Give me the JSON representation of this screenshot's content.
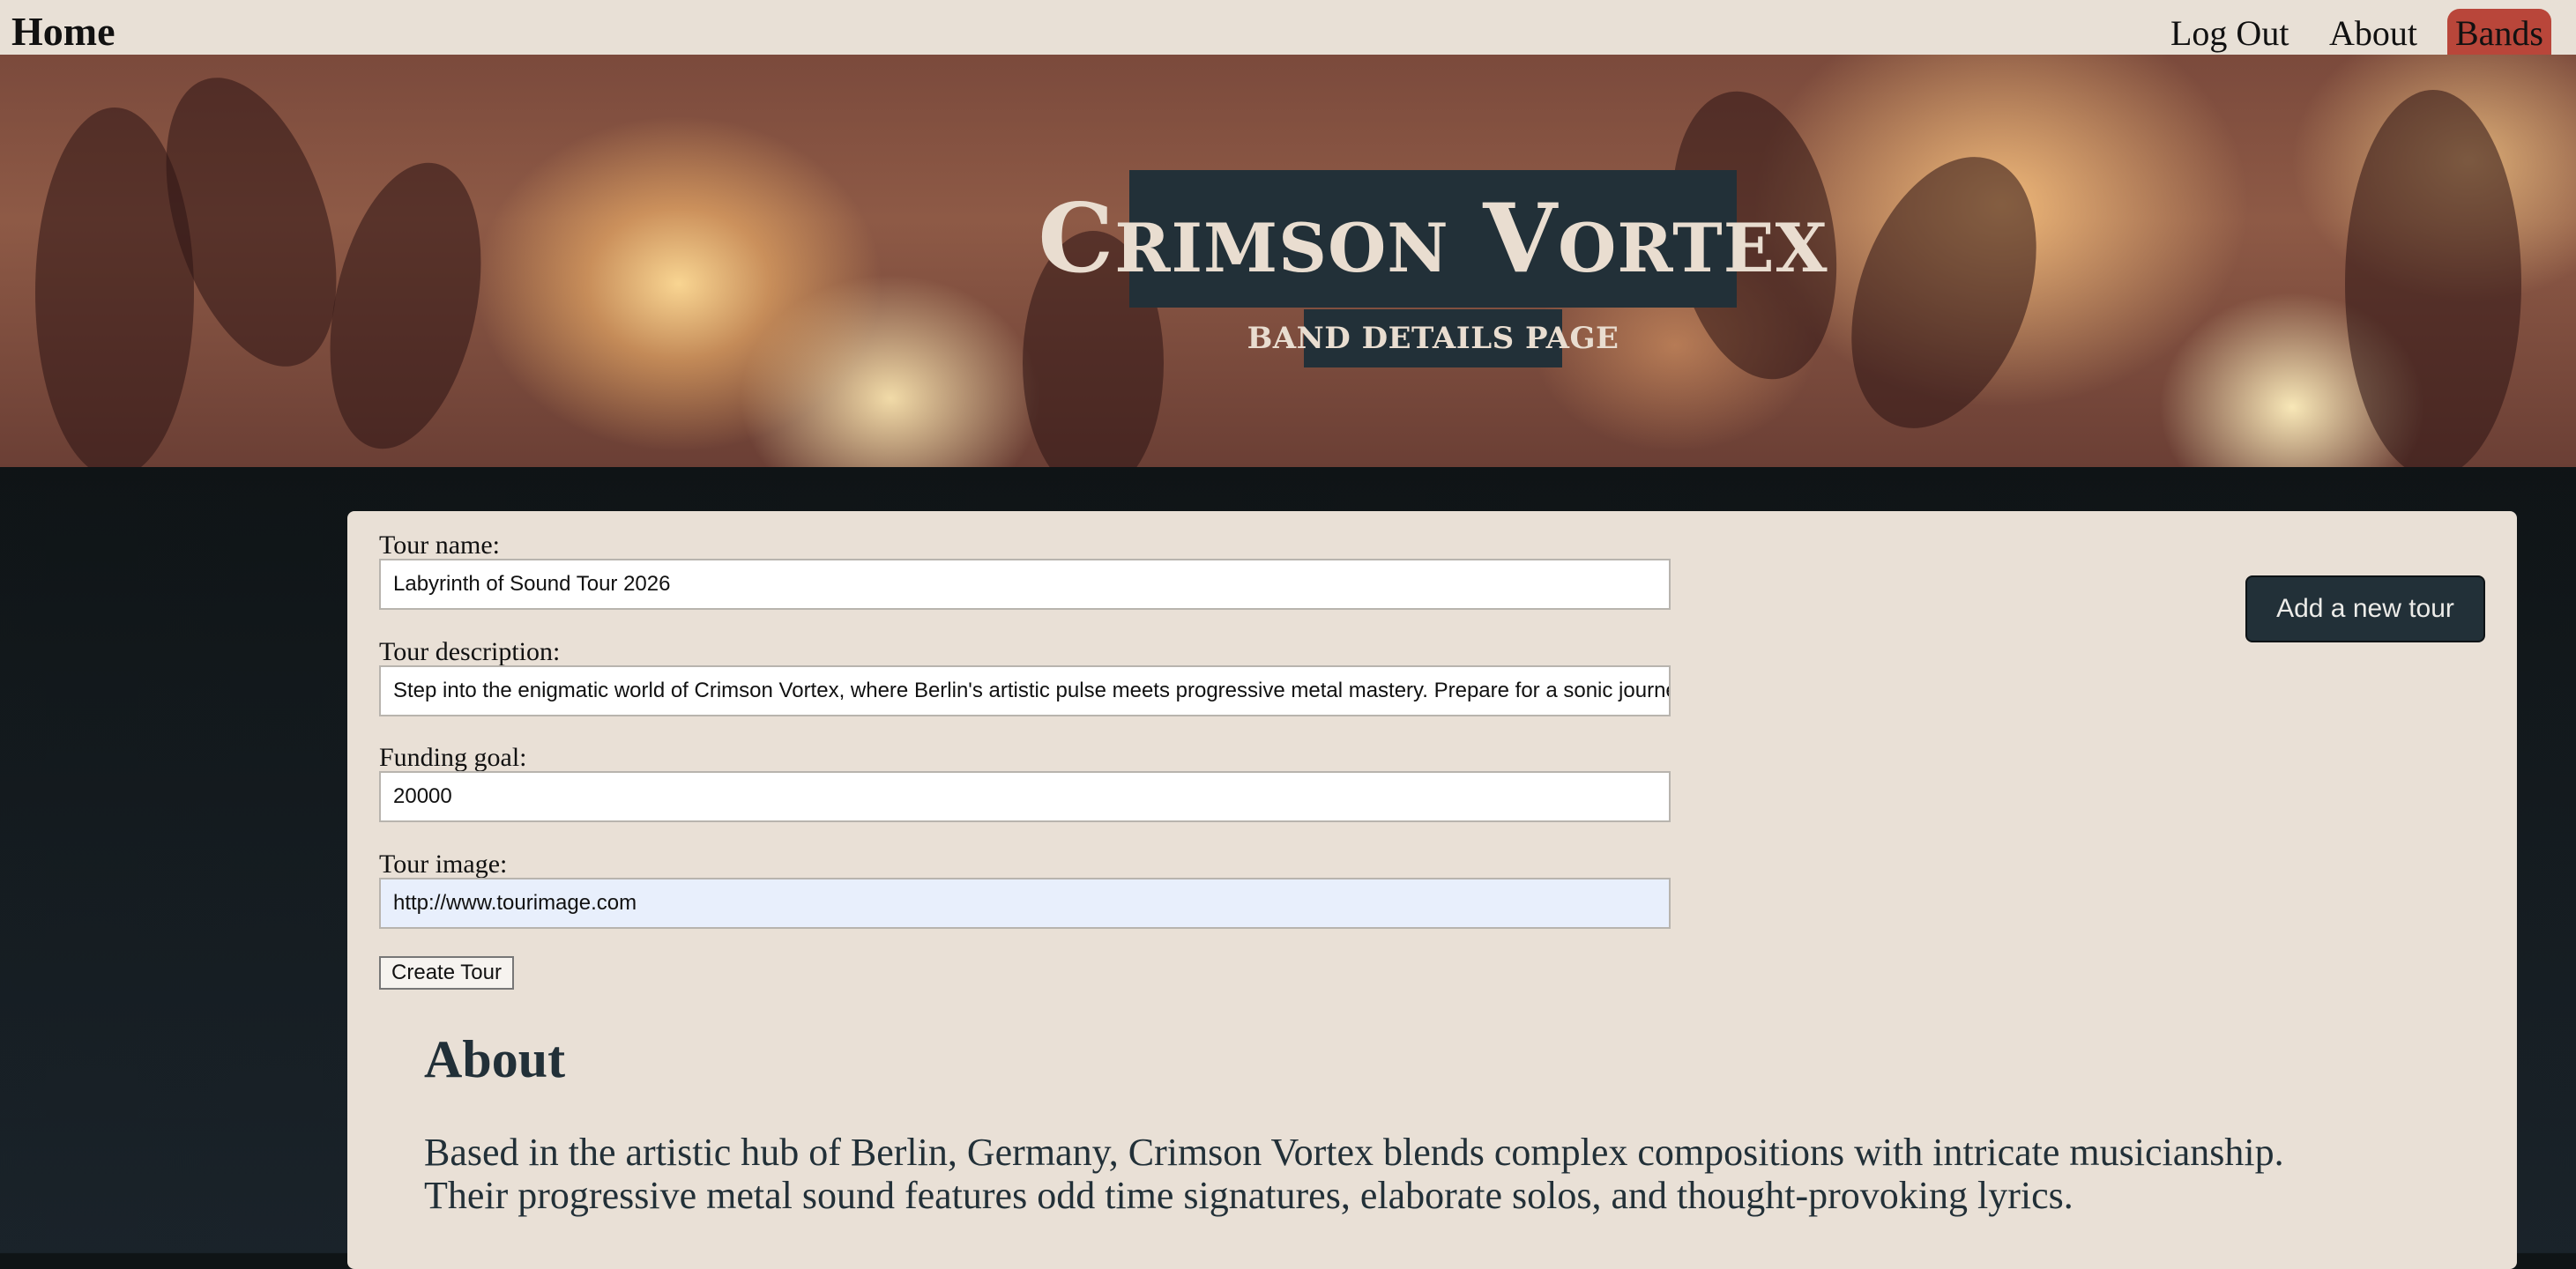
{
  "nav": {
    "home_label": "Home",
    "logout_label": "Log Out",
    "about_label": "About",
    "bands_label": "Bands"
  },
  "hero": {
    "band_name": "Crimson Vortex",
    "subtitle": "Band Details Page"
  },
  "tour_form": {
    "name_label": "Tour name:",
    "name_value": "Labyrinth of Sound Tour 2026",
    "description_label": "Tour description:",
    "description_value": "Step into the enigmatic world of Crimson Vortex, where Berlin's artistic pulse meets progressive metal mastery. Prepare for a sonic journey",
    "funding_label": "Funding goal:",
    "funding_value": "20000",
    "image_label": "Tour image:",
    "image_value": "http://www.tourimage.com",
    "submit_label": "Create Tour"
  },
  "actions": {
    "add_tour_label": "Add a new tour"
  },
  "about": {
    "heading": "About",
    "text": "Based in the artistic hub of Berlin, Germany, Crimson Vortex blends complex compositions with intricate musicianship. Their progressive metal sound features odd time signatures, elaborate solos, and thought-provoking lyrics."
  },
  "colors": {
    "nav_bg": "#e8e0d6",
    "active_tab": "#b9463a",
    "dark_accent": "#223038",
    "panel_bg": "#e9e0d6",
    "page_bg": "#0f1416"
  }
}
